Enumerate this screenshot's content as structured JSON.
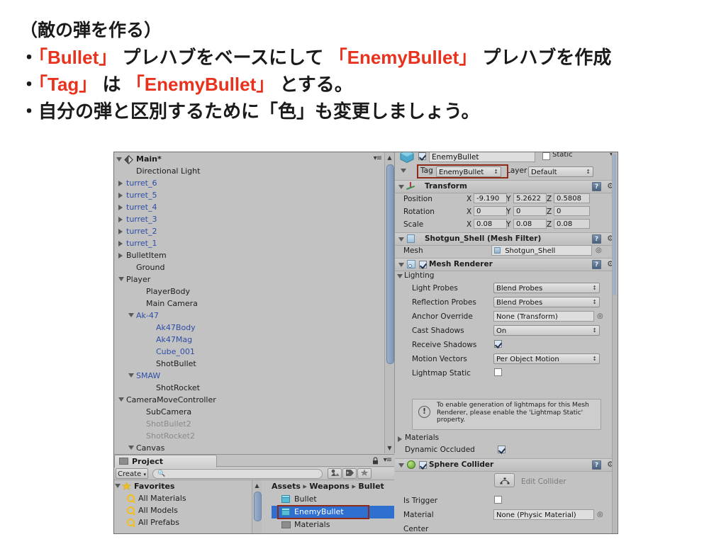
{
  "slide": {
    "lines": [
      {
        "segments": [
          {
            "t": "（敵の弾を作る）",
            "c": "black"
          }
        ]
      },
      {
        "segments": [
          {
            "t": "・",
            "c": "black"
          },
          {
            "t": "「Bullet」",
            "c": "red"
          },
          {
            "t": " プレハブをベースにして ",
            "c": "black"
          },
          {
            "t": "「EnemyBullet」",
            "c": "red"
          },
          {
            "t": " プレハブを作成",
            "c": "black"
          }
        ]
      },
      {
        "segments": [
          {
            "t": "・",
            "c": "black"
          },
          {
            "t": "「Tag」",
            "c": "red"
          },
          {
            "t": " は ",
            "c": "black"
          },
          {
            "t": "「EnemyBullet」",
            "c": "red"
          },
          {
            "t": " とする。",
            "c": "black"
          }
        ]
      },
      {
        "segments": [
          {
            "t": "・自分の弾と区別するために「色」も変更しましょう。",
            "c": "black"
          }
        ]
      }
    ],
    "accent_red": "#e8321e",
    "text_black": "#1a1a1a"
  },
  "hierarchy": {
    "scene_name": "Main*",
    "menu_icon": "options-menu-icon",
    "items": [
      {
        "label": "Directional Light",
        "indent": 1,
        "arrow": "none",
        "color": "black"
      },
      {
        "label": "turret_6",
        "indent": 0,
        "arrow": "right",
        "color": "blue"
      },
      {
        "label": "turret_5",
        "indent": 0,
        "arrow": "right",
        "color": "blue"
      },
      {
        "label": "turret_4",
        "indent": 0,
        "arrow": "right",
        "color": "blue"
      },
      {
        "label": "turret_3",
        "indent": 0,
        "arrow": "right",
        "color": "blue"
      },
      {
        "label": "turret_2",
        "indent": 0,
        "arrow": "right",
        "color": "blue"
      },
      {
        "label": "turret_1",
        "indent": 0,
        "arrow": "right",
        "color": "blue"
      },
      {
        "label": "BulletItem",
        "indent": 0,
        "arrow": "right",
        "color": "black"
      },
      {
        "label": "Ground",
        "indent": 1,
        "arrow": "none",
        "color": "black"
      },
      {
        "label": "Player",
        "indent": 0,
        "arrow": "down",
        "color": "black"
      },
      {
        "label": "PlayerBody",
        "indent": 2,
        "arrow": "none",
        "color": "black"
      },
      {
        "label": "Main Camera",
        "indent": 2,
        "arrow": "none",
        "color": "black"
      },
      {
        "label": "Ak-47",
        "indent": 1,
        "arrow": "down",
        "color": "blue"
      },
      {
        "label": "Ak47Body",
        "indent": 3,
        "arrow": "none",
        "color": "blue"
      },
      {
        "label": "Ak47Mag",
        "indent": 3,
        "arrow": "none",
        "color": "blue"
      },
      {
        "label": "Cube_001",
        "indent": 3,
        "arrow": "none",
        "color": "blue"
      },
      {
        "label": "ShotBullet",
        "indent": 3,
        "arrow": "none",
        "color": "black"
      },
      {
        "label": "SMAW",
        "indent": 1,
        "arrow": "down",
        "color": "blue"
      },
      {
        "label": "ShotRocket",
        "indent": 3,
        "arrow": "none",
        "color": "black"
      },
      {
        "label": "CameraMoveController",
        "indent": 0,
        "arrow": "down",
        "color": "black"
      },
      {
        "label": "SubCamera",
        "indent": 2,
        "arrow": "none",
        "color": "black"
      },
      {
        "label": "ShotBullet2",
        "indent": 2,
        "arrow": "none",
        "color": "gray"
      },
      {
        "label": "ShotRocket2",
        "indent": 2,
        "arrow": "none",
        "color": "gray"
      },
      {
        "label": "Canvas",
        "indent": 1,
        "arrow": "down",
        "color": "black"
      }
    ]
  },
  "project": {
    "tab_label": "Project",
    "tab_icon": "folder-icon",
    "lock_icon": "lock-icon",
    "menu_icon": "options-menu-icon",
    "create_button": "Create",
    "search_placeholder": "",
    "filter_buttons": [
      "type-filter-icon",
      "label-filter-icon",
      "favorite-filter-icon"
    ],
    "favorites": {
      "root_label": "Favorites",
      "items": [
        "All Materials",
        "All Models",
        "All Prefabs"
      ]
    },
    "breadcrumb": [
      "Assets",
      "Weapons",
      "Bullet"
    ],
    "assets": [
      {
        "label": "Bullet",
        "icon": "prefab-cube-icon",
        "selected": false
      },
      {
        "label": "EnemyBullet",
        "icon": "prefab-cube-icon",
        "selected": true
      },
      {
        "label": "Materials",
        "icon": "folder-icon",
        "selected": false
      }
    ]
  },
  "inspector": {
    "object_name": "EnemyBullet",
    "object_enabled": true,
    "static_label": "Static",
    "tag_label": "Tag",
    "tag_value": "EnemyBullet",
    "layer_label": "Layer",
    "layer_value": "Default",
    "transform": {
      "title": "Transform",
      "rows": [
        {
          "label": "Position",
          "x": "-9.190",
          "y": "5.2622",
          "z": "0.5808"
        },
        {
          "label": "Rotation",
          "x": "0",
          "y": "0",
          "z": "0"
        },
        {
          "label": "Scale",
          "x": "0.08",
          "y": "0.08",
          "z": "0.08"
        }
      ],
      "axis_labels": [
        "X",
        "Y",
        "Z"
      ]
    },
    "mesh_filter": {
      "title": "Shotgun_Shell (Mesh Filter)",
      "mesh_label": "Mesh",
      "mesh_value": "Shotgun_Shell"
    },
    "mesh_renderer": {
      "title": "Mesh Renderer",
      "enabled": true,
      "lighting_label": "Lighting",
      "rows": [
        {
          "label": "Light Probes",
          "value": "Blend Probes",
          "type": "popup"
        },
        {
          "label": "Reflection Probes",
          "value": "Blend Probes",
          "type": "popup"
        },
        {
          "label": "Anchor Override",
          "value": "None (Transform)",
          "type": "object"
        },
        {
          "label": "Cast Shadows",
          "value": "On",
          "type": "popup"
        },
        {
          "label": "Receive Shadows",
          "value": "",
          "type": "checkbox",
          "checked": true
        },
        {
          "label": "Motion Vectors",
          "value": "Per Object Motion",
          "type": "popup"
        },
        {
          "label": "Lightmap Static",
          "value": "",
          "type": "checkbox",
          "checked": false
        }
      ],
      "note": "To enable generation of lightmaps for this Mesh Renderer, please enable the 'Lightmap Static' property.",
      "note_icon": "warning-icon",
      "materials_label": "Materials",
      "dynamic_occluded_label": "Dynamic Occluded",
      "dynamic_occluded_checked": true
    },
    "sphere_collider": {
      "title": "Sphere Collider",
      "enabled": true,
      "edit_collider_label": "Edit Collider",
      "edit_collider_icon": "edit-collider-icon",
      "rows": [
        {
          "label": "Is Trigger",
          "value": "",
          "type": "checkbox",
          "checked": false
        },
        {
          "label": "Material",
          "value": "None (Physic Material)",
          "type": "object"
        },
        {
          "label": "Center",
          "value": "",
          "type": "none"
        }
      ]
    },
    "help_icon": "help-icon",
    "settings_icon": "gear-icon",
    "highlight_color": "#8e2a16"
  }
}
